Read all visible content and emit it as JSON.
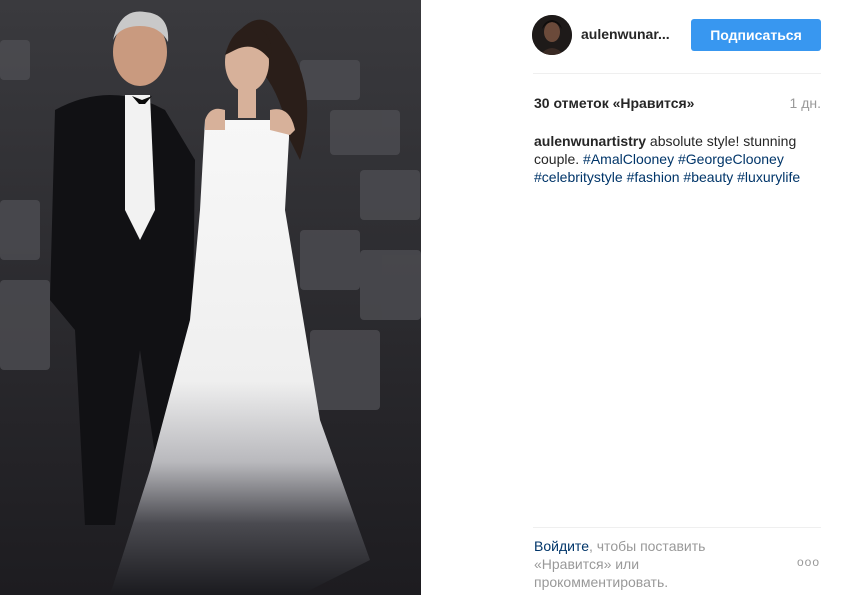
{
  "post": {
    "username": "aulenwunar...",
    "follow_label": "Подписаться",
    "likes": "30 отметок «Нравится»",
    "time": "1 дн.",
    "caption_user": "aulenwunartistry",
    "caption_text_1": " absolute style! stunning couple. ",
    "hashtags": [
      "#AmalClooney",
      "#GeorgeClooney",
      "#celebritystyle",
      "#fashion",
      "#beauty",
      "#luxurylife"
    ],
    "login_link": "Войдите",
    "login_text": ", чтобы поставить «Нравится» или прокомментировать.",
    "more": "ooo"
  },
  "icons": {
    "more": "more-options-icon"
  },
  "colors": {
    "accent": "#3897f0",
    "hashtag": "#003569",
    "muted": "#999999"
  }
}
